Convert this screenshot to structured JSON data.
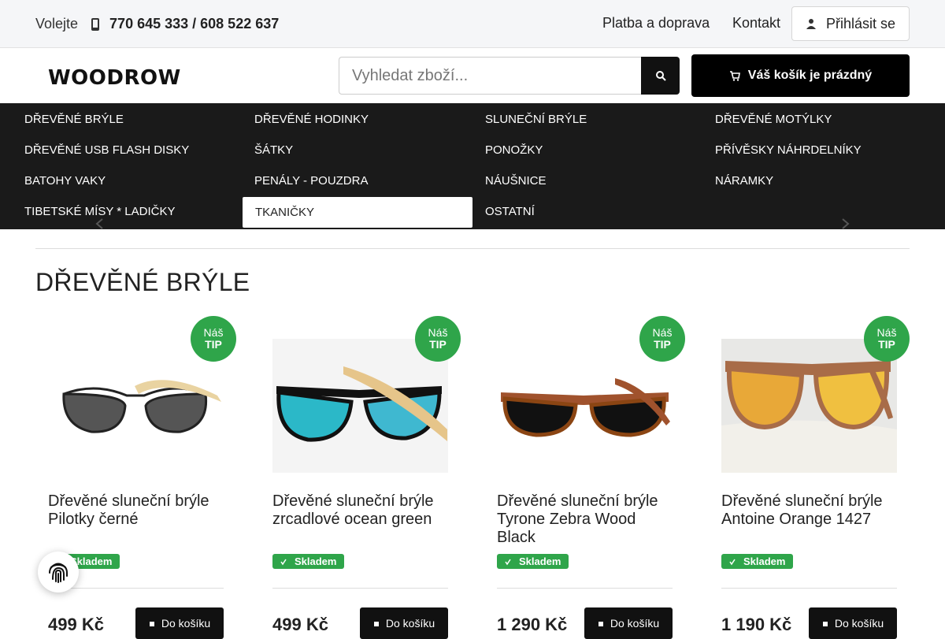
{
  "topbar": {
    "call_label": "Volejte",
    "phone": "770 645 333 / 608 522 637",
    "links": [
      "Platba a doprava",
      "Kontakt"
    ],
    "login_label": "Přihlásit se"
  },
  "header": {
    "logo": "WOODROW",
    "search_placeholder": "Vyhledat zboží...",
    "cart_label": "Váš košík je prázdný"
  },
  "categories": [
    "DŘEVĚNÉ BRÝLE",
    "DŘEVĚNÉ HODINKY",
    "SLUNEČNÍ BRÝLE",
    "DŘEVĚNÉ MOTÝLKY",
    "DŘEVĚNÉ USB FLASH DISKY",
    "ŠÁTKY",
    "PONOŽKY",
    "PŘÍVĚSKY NÁHRDELNÍKY",
    "BATOHY VAKY",
    "PENÁLY - POUZDRA",
    "NÁUŠNICE",
    "NÁRAMKY",
    "TIBETSKÉ MÍSY * LADIČKY",
    "TKANIČKY",
    "OSTATNÍ"
  ],
  "active_category": "TKANIČKY",
  "page_title": "DŘEVĚNÉ BRÝLE",
  "badge": {
    "line1": "Náš",
    "line2": "TIP"
  },
  "stock_label": "Skladem",
  "add_label": "Do košíku",
  "products": [
    {
      "name": "Dřevěné sluneční brýle Pilotky černé",
      "price": "499 Kč"
    },
    {
      "name": "Dřevěné sluneční brýle zrcadlové ocean green",
      "price": "499 Kč"
    },
    {
      "name": "Dřevěné sluneční brýle Tyrone Zebra Wood Black",
      "price": "1 290 Kč"
    },
    {
      "name": "Dřevěné sluneční brýle Antoine Orange 1427",
      "price": "1 190 Kč"
    }
  ],
  "colors": {
    "accent_green": "#2fa54a",
    "nav_bg": "#1a1a1a",
    "button_dark": "#111111"
  },
  "icons": [
    "phone-icon",
    "user-icon",
    "search-icon",
    "cart-icon",
    "check-icon",
    "fingerprint-icon",
    "chevron-left-icon",
    "chevron-right-icon"
  ]
}
